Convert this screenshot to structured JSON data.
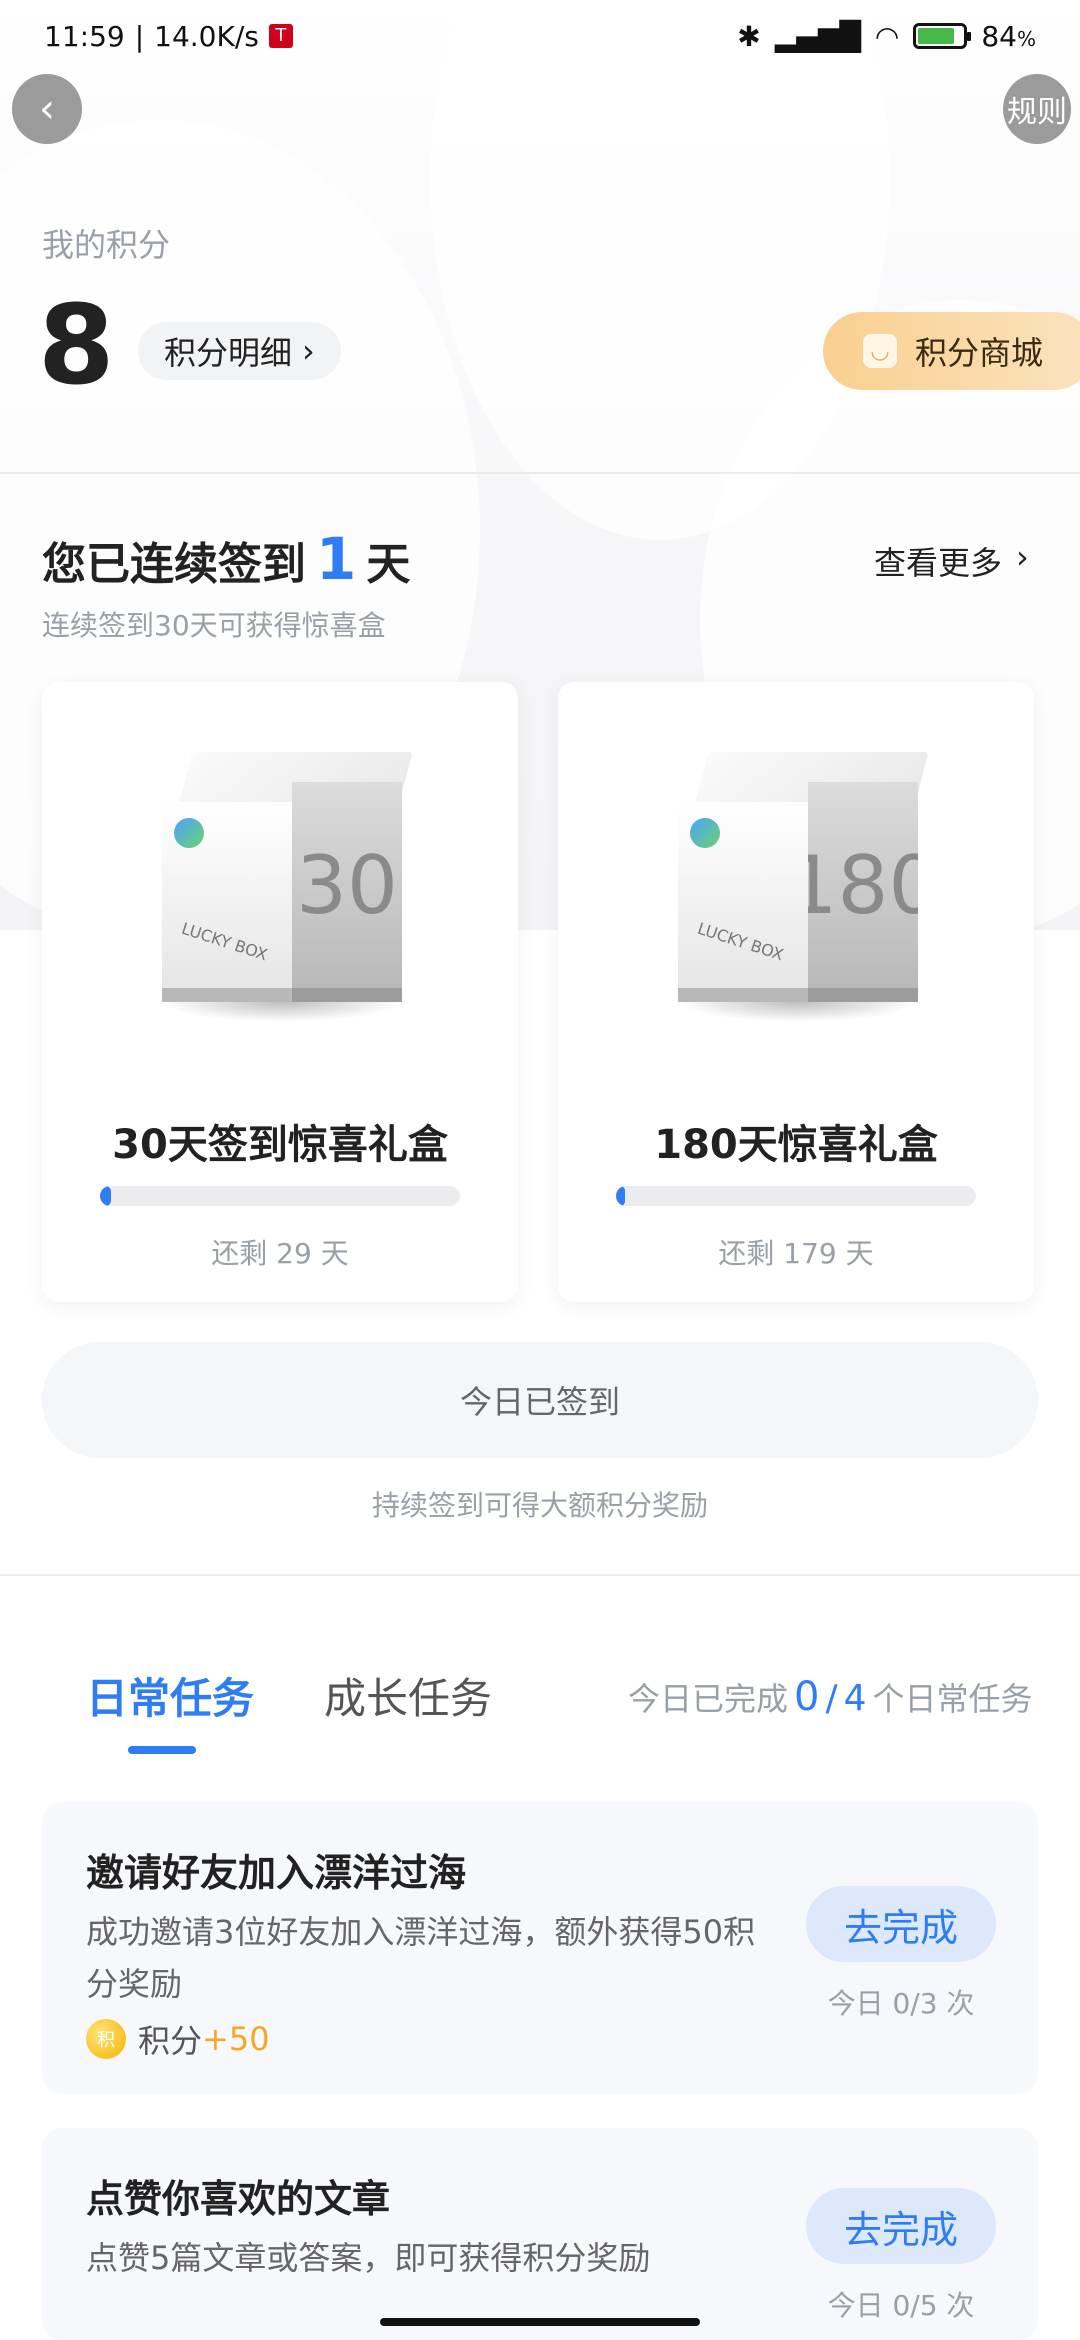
{
  "status_bar": {
    "time": "11:59",
    "net_speed": "14.0K/s",
    "battery_percent": "84",
    "battery_unit": "%"
  },
  "header": {
    "back_icon": "chevron-left-icon",
    "rules_label": "规则"
  },
  "points": {
    "label": "我的积分",
    "value": "8",
    "detail_label": "积分明细",
    "mall_label": "积分商城"
  },
  "signin": {
    "title_prefix": "您已连续签到",
    "days": "1",
    "title_suffix": "天",
    "more_label": "查看更多",
    "subtitle": "连续签到30天可获得惊喜盒",
    "boxes": [
      {
        "box_number": "30",
        "title": "30天签到惊喜礼盒",
        "remaining": "还剩 29 天",
        "progress": 0.03
      },
      {
        "box_number": "180",
        "title": "180天惊喜礼盒",
        "remaining": "还剩 179 天",
        "progress": 0.01
      }
    ],
    "signed_button": "今日已签到",
    "signed_hint": "持续签到可得大额积分奖励"
  },
  "tasks": {
    "tabs": [
      {
        "label": "日常任务",
        "active": true
      },
      {
        "label": "成长任务",
        "active": false
      }
    ],
    "progress_prefix": "今日已完成",
    "completed": "0",
    "slash": "/",
    "total": "4",
    "progress_suffix": "个日常任务",
    "items": [
      {
        "title": "邀请好友加入漂洋过海",
        "description": "成功邀请3位好友加入漂洋过海，额外获得50积分奖励",
        "reward_label": "积分",
        "reward_amount": "+50",
        "button": "去完成",
        "count": "今日 0/3 次"
      },
      {
        "title": "点赞你喜欢的文章",
        "description": "点赞5篇文章或答案，即可获得积分奖励",
        "button": "去完成",
        "count": "今日 0/5 次"
      }
    ]
  },
  "colors": {
    "accent": "#2f7df6",
    "reward": "#f5a623",
    "mall_gradient_start": "#f9cf8f"
  }
}
